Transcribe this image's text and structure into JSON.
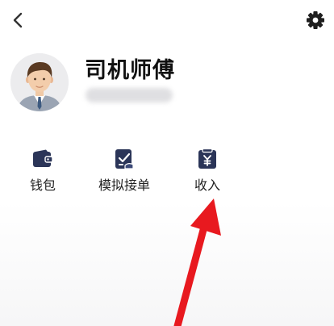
{
  "profile": {
    "name": "司机师傅",
    "avatar_icon": "driver-avatar-icon"
  },
  "topbar": {
    "back_icon": "chevron-left-icon",
    "settings_icon": "gear-icon"
  },
  "shortcuts": [
    {
      "label": "钱包",
      "icon": "wallet-icon"
    },
    {
      "label": "模拟接单",
      "icon": "simulate-order-icon"
    },
    {
      "label": "收入",
      "icon": "income-icon"
    }
  ],
  "annotation": {
    "arrow_color": "#e8191f",
    "points_to": "收入"
  },
  "colors": {
    "icon": "#2b3558",
    "text": "#222222"
  }
}
